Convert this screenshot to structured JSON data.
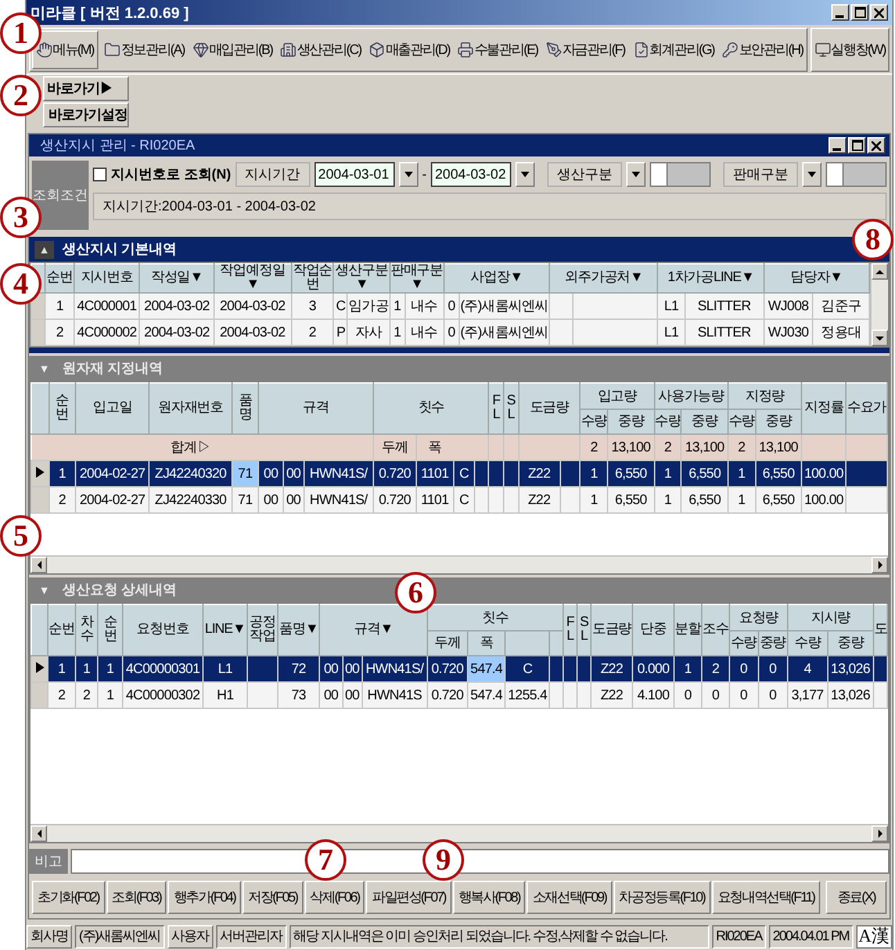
{
  "window": {
    "title": "미라클 [ 버전 1.2.0.69 ]"
  },
  "callouts": [
    {
      "label": "1"
    },
    {
      "label": "2"
    },
    {
      "label": "3"
    },
    {
      "label": "4"
    },
    {
      "label": "5"
    },
    {
      "label": "6"
    },
    {
      "label": "7"
    },
    {
      "label": "8"
    },
    {
      "label": "9"
    }
  ],
  "toolbar": {
    "items": [
      {
        "label": "메뉴(M)"
      },
      {
        "label": "정보관리(A)"
      },
      {
        "label": "매입관리(B)"
      },
      {
        "label": "생산관리(C)"
      },
      {
        "label": "매출관리(D)"
      },
      {
        "label": "수불관리(E)"
      },
      {
        "label": "자금관리(F)"
      },
      {
        "label": "회계관리(G)"
      },
      {
        "label": "보안관리(H)"
      }
    ],
    "run": {
      "label": "실행창(W)"
    }
  },
  "shortcuts": [
    "바로가기▶",
    "바로가기설정"
  ],
  "form": {
    "title": "생산지시 관리 - RI020EA",
    "query": {
      "label": "조회조건",
      "by_number": {
        "label": "지시번호로 조회(N)",
        "checked": false
      },
      "period_label": "지시기간",
      "date_from": "2004-03-01",
      "dash": "-",
      "date_to": "2004-03-02",
      "filters": [
        {
          "label": "생산구분"
        },
        {
          "label": "판매구분"
        }
      ],
      "summary": "지시기간:2004-03-01 - 2004-03-02"
    },
    "sections": [
      {
        "kind": "primary",
        "toggle": "▲",
        "title": "생산지시 기본내역",
        "table": {
          "columns": [
            {
              "label": "순번"
            },
            {
              "label": "지시번호"
            },
            {
              "label": "작성일▼"
            },
            {
              "label": "작업예정일▼"
            },
            {
              "label": "작업순번"
            },
            {
              "label": "생산구분▼"
            },
            {
              "label": "판매구분▼"
            },
            {
              "label": "사업장▼"
            },
            {
              "label": "외주가공처▼"
            },
            {
              "label": "1차가공LINE▼"
            },
            {
              "label": "담당자▼"
            }
          ],
          "rows": [
            {
              "kind": "data",
              "selected": false,
              "cells": [
                "1",
                "4C000001",
                "2004-03-02",
                "2004-03-02",
                "3",
                [
                  "C",
                  "임가공"
                ],
                [
                  "1",
                  "내수"
                ],
                [
                  "0",
                  "(주)새롬씨엔씨"
                ],
                [
                  null,
                  null
                ],
                [
                  "L1",
                  "SLITTER"
                ],
                [
                  "WJ008",
                  "김준구"
                ]
              ]
            },
            {
              "kind": "data",
              "selected": false,
              "cells": [
                "2",
                "4C000002",
                "2004-03-02",
                "2004-03-02",
                "2",
                [
                  "P",
                  "자사"
                ],
                [
                  "1",
                  "내수"
                ],
                [
                  "0",
                  "(주)새롬씨엔씨"
                ],
                [
                  null,
                  null
                ],
                [
                  "L1",
                  "SLITTER"
                ],
                [
                  "WJ030",
                  "정용대"
                ]
              ]
            }
          ]
        }
      },
      {
        "kind": "secondary",
        "toggle": "▼",
        "title": "원자재 지정내역",
        "table": {
          "columns": [
            {
              "label": "순번"
            },
            {
              "label": "입고일"
            },
            {
              "label": "원자재번호"
            },
            {
              "label": "품명"
            },
            {
              "label": "규격"
            },
            {
              "label": "칫수"
            },
            {
              "label": "FL"
            },
            {
              "label": "SL"
            },
            {
              "label": "도금량"
            },
            {
              "label": "입고량",
              "children": [
                "수량",
                "중량"
              ]
            },
            {
              "label": "사용가능량",
              "children": [
                "수량",
                "중량"
              ]
            },
            {
              "label": "지정량",
              "children": [
                "수량",
                "중량"
              ]
            },
            {
              "label": "지정률"
            },
            {
              "label": "수요가"
            }
          ],
          "rows": [
            {
              "kind": "total",
              "cells": [
                "",
                "",
                "합계▷",
                "",
                "",
                [
                  "두께",
                  "폭",
                  null,
                  null
                ],
                null,
                null,
                [
                  null,
                  null
                ],
                [
                  "2",
                  "13,100"
                ],
                [
                  "2",
                  "13,100"
                ],
                [
                  "2",
                  "13,100"
                ],
                null,
                null
              ]
            },
            {
              "kind": "data",
              "selected": true,
              "cells": [
                "1",
                "2004-02-27",
                "ZJ42240320",
                {
                  "text": "71",
                  "focused": true
                },
                [
                  "00",
                  "00",
                  "HWN41S/"
                ],
                [
                  "0.720",
                  "1101",
                  "C",
                  null
                ],
                null,
                null,
                [
                  "Z22",
                  null
                ],
                [
                  "1",
                  "6,550"
                ],
                [
                  "1",
                  "6,550"
                ],
                [
                  "1",
                  "6,550"
                ],
                "100.00",
                null
              ]
            },
            {
              "kind": "data",
              "selected": false,
              "cells": [
                "2",
                "2004-02-27",
                "ZJ42240330",
                "71",
                [
                  "00",
                  "00",
                  "HWN41S/"
                ],
                [
                  "0.720",
                  "1101",
                  "C",
                  null
                ],
                null,
                null,
                [
                  "Z22",
                  null
                ],
                [
                  "1",
                  "6,550"
                ],
                [
                  "1",
                  "6,550"
                ],
                [
                  "1",
                  "6,550"
                ],
                "100.00",
                null
              ]
            }
          ]
        }
      },
      {
        "kind": "secondary",
        "toggle": "▼",
        "title": "생산요청 상세내역",
        "table": {
          "columns": [
            {
              "label": "순번"
            },
            {
              "label": "차수"
            },
            {
              "label": "순번"
            },
            {
              "label": "요청번호"
            },
            {
              "label": "LINE▼"
            },
            {
              "label": "공정작업"
            },
            {
              "label": "품명▼"
            },
            {
              "label": "규격▼"
            },
            {
              "label": "칫수",
              "children": [
                "두께",
                "폭"
              ]
            },
            {
              "label": "FL"
            },
            {
              "label": "SL"
            },
            {
              "label": "도금량"
            },
            {
              "label": "단중"
            },
            {
              "label": "분할"
            },
            {
              "label": "조수"
            },
            {
              "label": "요청량",
              "children": [
                "수량",
                "중량"
              ]
            },
            {
              "label": "지시량",
              "children": [
                "수량",
                "중량"
              ]
            },
            {
              "label": "도"
            }
          ],
          "rows": [
            {
              "kind": "data",
              "selected": true,
              "cells": [
                "1",
                "1",
                "1",
                "4C00000301",
                "L1",
                null,
                "72",
                [
                  "00",
                  "00",
                  "HWN41S/"
                ],
                [
                  "0.720",
                  {
                    "text": "547.4",
                    "focused": true
                  },
                  "C",
                  null
                ],
                null,
                null,
                "Z22",
                "0.000",
                "1",
                "2",
                [
                  "0",
                  "0"
                ],
                [
                  "4",
                  "13,026"
                ],
                null
              ]
            },
            {
              "kind": "data",
              "selected": false,
              "cells": [
                "2",
                "2",
                "1",
                "4C00000302",
                "H1",
                null,
                "73",
                [
                  "00",
                  "00",
                  "HWN41S"
                ],
                [
                  "0.720",
                  "547.4",
                  "1255.4",
                  null
                ],
                null,
                null,
                "Z22",
                "4.100",
                "0",
                "0",
                [
                  "0",
                  "0"
                ],
                [
                  "3,177",
                  "13,026"
                ],
                null
              ]
            }
          ]
        }
      }
    ],
    "memo": {
      "label": "비고"
    },
    "buttons": [
      "초기화(F02)",
      "조회(F03)",
      "행추가(F04)",
      "저장(F05)",
      "삭제(F06)",
      "파일편성(F07)",
      "행복사(F08)",
      "소재선택(F09)",
      "차공정등록(F10)",
      "요청내역선택(F11)"
    ],
    "close_button": "종료(X)"
  },
  "status_bar": {
    "fields": [
      {
        "label": "회사명",
        "value": "(주)새롬씨엔씨"
      },
      {
        "label": "사용자",
        "value": "서버관리자"
      }
    ],
    "message": "해당 지시내역은 이미 승인처리 되었습니다.   수정,삭제할 수 없습니다.",
    "screen_id": "RI020EA",
    "datetime": "2004.04.01 PM",
    "ime": "A漢"
  }
}
